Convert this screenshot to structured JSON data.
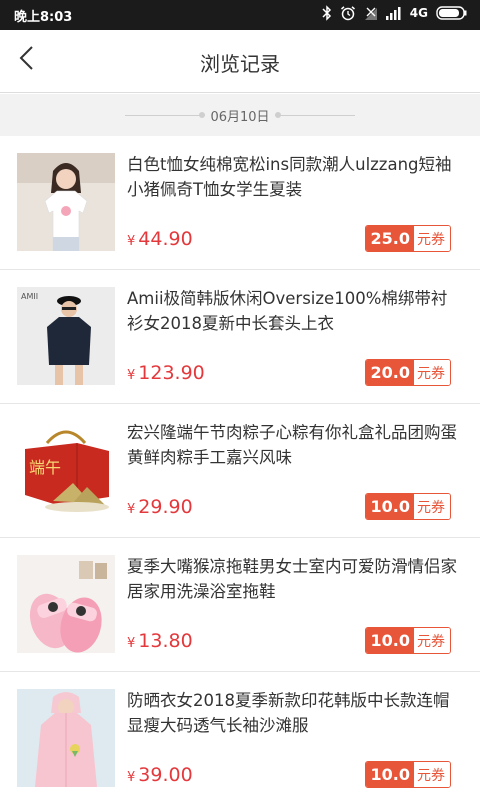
{
  "status_bar": {
    "time": "晚上8:03",
    "network": "4G",
    "icons": [
      "bluetooth-icon",
      "alarm-icon",
      "signal-off-icon",
      "signal-icon",
      "battery-icon"
    ]
  },
  "header": {
    "title": "浏览记录",
    "back_icon": "chevron-left-icon"
  },
  "date_section": {
    "date": "06月10日"
  },
  "colors": {
    "price": "#e4393c",
    "coupon": "#e8563a",
    "status_bar": "#1b1b1b",
    "divider_bg": "#f2f2f2"
  },
  "products": [
    {
      "title": "白色t恤女纯棉宽松ins同款潮人ulzzang短袖小猪佩奇T恤女学生夏装",
      "currency": "¥",
      "price": "44.90",
      "coupon_amount": "25.0",
      "coupon_label": "元券"
    },
    {
      "title": "Amii极简韩版休闲Oversize100%棉绑带衬衫女2018夏新中长套头上衣",
      "currency": "¥",
      "price": "123.90",
      "coupon_amount": "20.0",
      "coupon_label": "元券",
      "image_text": "AMII"
    },
    {
      "title": "宏兴隆端午节肉粽子心粽有你礼盒礼品团购蛋黄鲜肉粽手工嘉兴风味",
      "currency": "¥",
      "price": "29.90",
      "coupon_amount": "10.0",
      "coupon_label": "元券",
      "image_text": "端午"
    },
    {
      "title": "夏季大嘴猴凉拖鞋男女士室内可爱防滑情侣家居家用洗澡浴室拖鞋",
      "currency": "¥",
      "price": "13.80",
      "coupon_amount": "10.0",
      "coupon_label": "元券"
    },
    {
      "title": "防晒衣女2018夏季新款印花韩版中长款连帽显瘦大码透气长袖沙滩服",
      "currency": "¥",
      "price": "39.00",
      "coupon_amount": "10.0",
      "coupon_label": "元券"
    }
  ]
}
